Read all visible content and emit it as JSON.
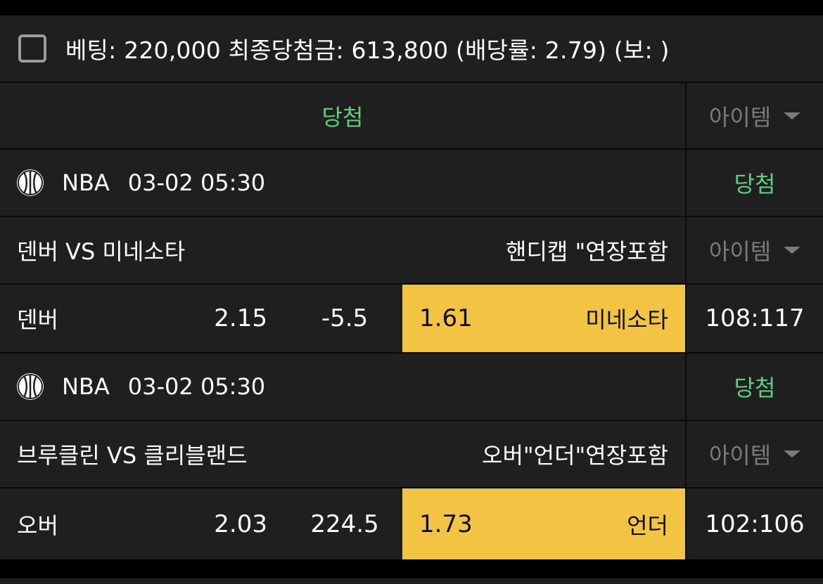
{
  "header": {
    "checkbox_checked": false,
    "summary": "베팅: 220,000 최종당첨금: 613,800 (배당률: 2.79) (보: )"
  },
  "overall": {
    "result": "당첨",
    "item_label": "아이템"
  },
  "games": [
    {
      "league": "NBA",
      "datetime": "03-02 05:30",
      "result": "당첨",
      "matchup": "덴버 VS 미네소타",
      "market": "핸디캡 \"연장포함",
      "item_label": "아이템",
      "home_team": "덴버",
      "home_odds": "2.15",
      "line": "-5.5",
      "away_odds": "1.61",
      "away_team": "미네소타",
      "selected": "away",
      "score": "108:117"
    },
    {
      "league": "NBA",
      "datetime": "03-02 05:30",
      "result": "당첨",
      "matchup": "브루클린 VS 클리블랜드",
      "market": "오버\"언더\"연장포함",
      "item_label": "아이템",
      "home_team": "오버",
      "home_odds": "2.03",
      "line": "224.5",
      "away_odds": "1.73",
      "away_team": "언더",
      "selected": "away",
      "score": "102:106"
    }
  ],
  "colors": {
    "background": "#000000",
    "card": "#1f1f1f",
    "divider": "#0a0a0a",
    "win_green": "#5fcf7e",
    "selected_yellow": "#f3c343",
    "muted": "#7b7b7b"
  },
  "icons": {
    "sport": "basketball-icon",
    "dropdown": "caret-down-icon",
    "checkbox": "checkbox-icon"
  }
}
